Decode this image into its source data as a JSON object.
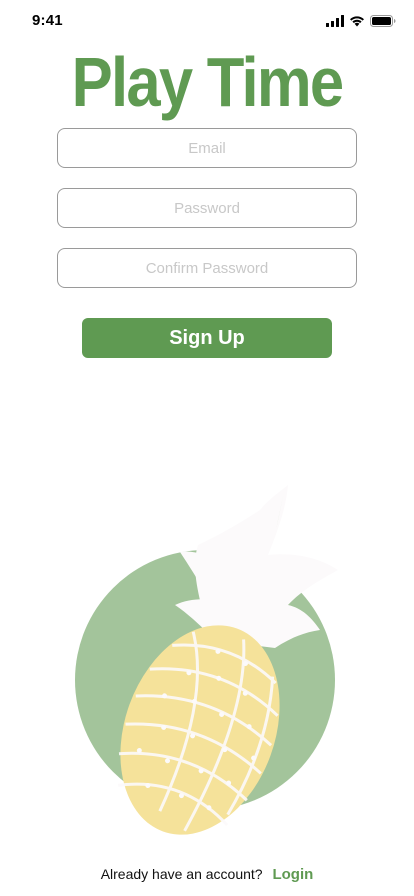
{
  "status_bar": {
    "time": "9:41"
  },
  "title": "Play Time",
  "form": {
    "email_placeholder": "Email",
    "password_placeholder": "Password",
    "confirm_placeholder": "Confirm Password",
    "signup_label": "Sign Up"
  },
  "footer": {
    "prompt": "Already have an account?",
    "login_label": "Login"
  },
  "colors": {
    "accent": "#5f9a52",
    "circle": "#a3c49b",
    "pineapple": "#f5e29a",
    "crown": "#fcfafb"
  },
  "icons": [
    "signal-icon",
    "wifi-icon",
    "battery-icon",
    "pineapple-illustration"
  ]
}
